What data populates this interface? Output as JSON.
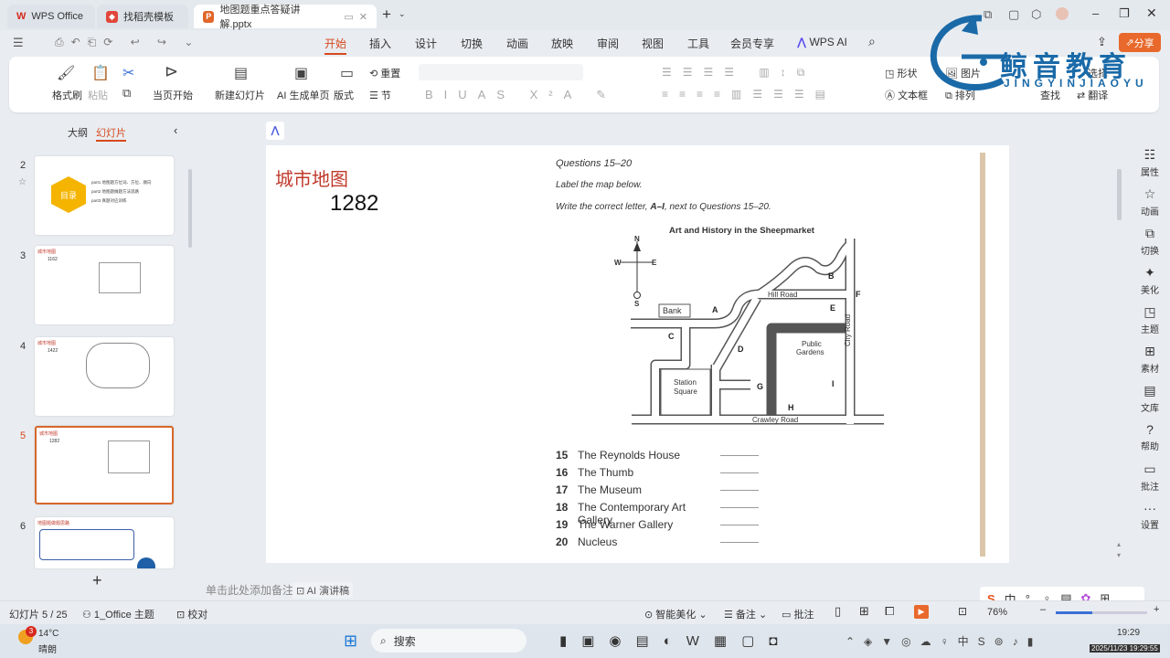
{
  "tabs": [
    {
      "label": "WPS Office"
    },
    {
      "label": "找稻壳模板"
    },
    {
      "label": "地图题重点答疑讲解.pptx",
      "active": true
    }
  ],
  "menu": [
    "开始",
    "插入",
    "设计",
    "切换",
    "动画",
    "放映",
    "审阅",
    "视图",
    "工具",
    "会员专享",
    "WPS AI"
  ],
  "share_label": "分享",
  "ribbon": {
    "format_painter": "格式刷",
    "paste": "粘贴",
    "play_current": "当页开始",
    "new_slide": "新建幻灯片",
    "ai_slide": "AI 生成单页",
    "layout": "版式",
    "reset": "重置",
    "section": "节",
    "shape": "形状",
    "picture": "图片",
    "textbox": "文本框",
    "arrange": "排列",
    "find": "查找",
    "select": "选择",
    "translate": "翻译"
  },
  "watermark": {
    "cn": "鲸音教育",
    "en": "JINGYINJIAOYU"
  },
  "panel": {
    "outline_tab": "大纲",
    "slides_tab": "幻灯片"
  },
  "thumbs": [
    {
      "num": "2",
      "title": "目录",
      "parts": [
        "part1  地图题方位词、方位、顺向",
        "part2  地图题做题方法思路",
        "part3  真题对应训练"
      ]
    },
    {
      "num": "3",
      "title": "城市地图",
      "code": "1162"
    },
    {
      "num": "4",
      "title": "城市地图",
      "code": "1422"
    },
    {
      "num": "5",
      "title": "城市地图",
      "code": "1282"
    },
    {
      "num": "6",
      "title": "地图题做题思路"
    }
  ],
  "slide": {
    "title": "城市地图",
    "code": "1282",
    "questions_heading": "Questions 15–20",
    "instr1": "Label the map below.",
    "instr2_pre": "Write the correct letter, ",
    "instr2_bold": "A–I",
    "instr2_post": ", next to Questions 15–20.",
    "map_title": "Art and History in the Sheepmarket",
    "compass": {
      "n": "N",
      "s": "S",
      "e": "E",
      "w": "W"
    },
    "map_labels": {
      "bank": "Bank",
      "hill": "Hill Road",
      "city": "City Road",
      "crawley": "Crawley Road",
      "station1": "Station",
      "station2": "Square",
      "public1": "Public",
      "public2": "Gardens"
    },
    "letters": [
      "A",
      "B",
      "C",
      "D",
      "E",
      "F",
      "G",
      "H",
      "I"
    ],
    "items": [
      {
        "n": "15",
        "t": "The Reynolds House"
      },
      {
        "n": "16",
        "t": "The Thumb"
      },
      {
        "n": "17",
        "t": "The Museum"
      },
      {
        "n": "18",
        "t": "The Contemporary Art Gallery"
      },
      {
        "n": "19",
        "t": "The Warner Gallery"
      },
      {
        "n": "20",
        "t": "Nucleus"
      }
    ]
  },
  "notes_placeholder": "单击此处添加备注",
  "ai_notes": "AI 演讲稿",
  "rightbar": [
    "属性",
    "动画",
    "切换",
    "美化",
    "主题",
    "素材",
    "文库",
    "帮助",
    "批注",
    "设置"
  ],
  "status": {
    "slide": "幻灯片 5 / 25",
    "theme": "1_Office 主题",
    "proof": "校对",
    "beautify": "智能美化",
    "notes": "备注",
    "comment": "批注",
    "zoom": "76%"
  },
  "taskbar": {
    "temp": "14°C",
    "weather": "晴朗",
    "search": "搜索",
    "time": "19:29",
    "datetime": "2025/11/23 19:29:55",
    "badge": "3"
  },
  "colors": {
    "accent": "#d7481d",
    "title_red": "#c0392b",
    "brand_blue": "#1a6aa8"
  }
}
